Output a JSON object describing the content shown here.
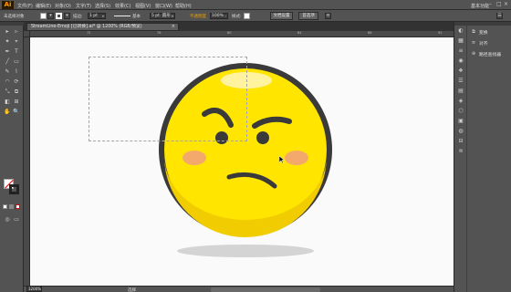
{
  "app": {
    "logo": "Ai",
    "workspace": "基本功能"
  },
  "menu": [
    "文件(F)",
    "编辑(E)",
    "对象(O)",
    "文字(T)",
    "选择(S)",
    "效果(C)",
    "视图(V)",
    "窗口(W)",
    "帮助(H)"
  ],
  "window_controls": [
    "–",
    "□",
    "×"
  ],
  "control_bar": {
    "selection_label": "未选择对象",
    "stroke_label": "描边:",
    "stroke_value": "1 pt",
    "brush_label": "基本",
    "points_value": "5 pt. 圆形",
    "opacity_label": "不透明度",
    "opacity_value": "100%",
    "style_label": "样式:",
    "doc_setup_button": "文档设置",
    "preferences_button": "首选项"
  },
  "document": {
    "tab_title": "StreamLine-Emoji [已转换].ai* @ 1200% (RGB/预览)",
    "close_glyph": "×"
  },
  "ruler": {
    "ticks": [
      "72",
      "76",
      "80",
      "84",
      "88",
      "92"
    ]
  },
  "status": {
    "zoom": "1200%",
    "tool_name": "选择"
  },
  "tools": [
    "▸",
    "▹",
    "✦",
    "⌖",
    "✒",
    "T",
    "╱",
    "▭",
    "✎",
    "⌇",
    "◠",
    "⟳",
    "⤡",
    "⧉",
    "◧",
    "⊞",
    "✋",
    "🔍"
  ],
  "right_icons": [
    "◐",
    "▦",
    "≡",
    "◉",
    "❖",
    "☰",
    "▤",
    "◈",
    "⬡",
    "▣",
    "◍",
    "⊟",
    "≋"
  ],
  "right_panels": [
    {
      "icon": "⧉",
      "label": "变换"
    },
    {
      "icon": "≡",
      "label": "对齐"
    },
    {
      "icon": "⊕",
      "label": "路径查找器"
    }
  ],
  "colors": {
    "ui_dark": "#535353",
    "canvas": "#fafafa",
    "face_yellow": "#ffe500",
    "face_shadow": "#e8c800",
    "outline": "#3a3a3a",
    "blush": "#f3a96b",
    "shadow": "#d4d4d4"
  }
}
